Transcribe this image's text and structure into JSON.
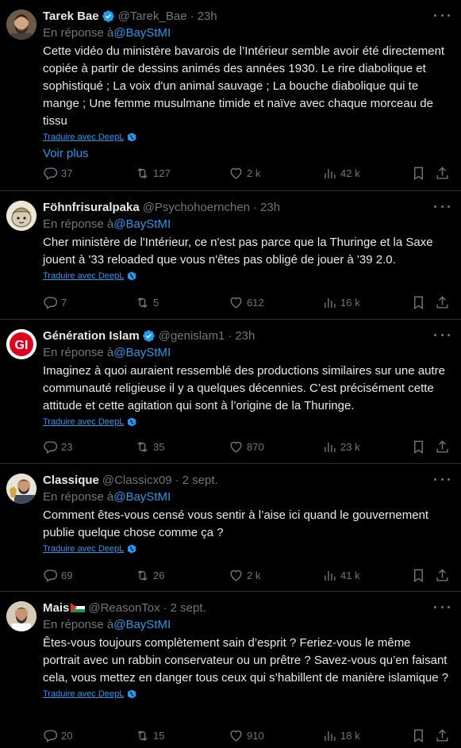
{
  "tweets": [
    {
      "name": "Tarek Bae",
      "verified": true,
      "handle": "@Tarek_Bae",
      "time": "23h",
      "reply_prefix": "En réponse à",
      "reply_to": "@BayStMI",
      "text": "Cette vidéo du ministère bavarois de l’Intérieur semble avoir été directement copiée à partir de dessins animés des années 1930. Le rire diabolique et sophistiqué ; La voix d'un animal sauvage ; La bouche diabolique qui te mange ; Une femme musulmane timide et naïve avec chaque morceau de tissu",
      "translate": "Traduire avec DeepL",
      "see_more": "Voir plus",
      "replies": "37",
      "retweets": "127",
      "likes": "2 k",
      "views": "42 k"
    },
    {
      "name": "Föhnfrisuralpaka",
      "verified": false,
      "handle": "@Psychohoernchen",
      "time": "23h",
      "reply_prefix": "En réponse à",
      "reply_to": "@BayStMI",
      "text": "Cher ministère de l'Intérieur, ce n'est pas parce que la Thuringe et la Saxe jouent à '33 reloaded que vous n'êtes pas obligé de jouer à '39 2.0.",
      "translate": "Traduire avec DeepL",
      "replies": "7",
      "retweets": "5",
      "likes": "612",
      "views": "16 k"
    },
    {
      "name": "Génération Islam",
      "verified": true,
      "handle": "@genislam1",
      "time": "23h",
      "reply_prefix": "En réponse à",
      "reply_to": "@BayStMI",
      "text": "Imaginez à quoi auraient ressemblé des productions similaires sur une autre communauté religieuse il y a quelques décennies. C’est précisément cette attitude et cette agitation qui sont à l’origine de la Thuringe.",
      "translate": "Traduire avec DeepL",
      "replies": "23",
      "retweets": "35",
      "likes": "870",
      "views": "23 k"
    },
    {
      "name": "Classique",
      "verified": false,
      "handle": "@Classicx09",
      "time": "2 sept.",
      "reply_prefix": "En réponse à",
      "reply_to": "@BayStMI",
      "text": "Comment êtes-vous censé vous sentir à l’aise ici quand le gouvernement publie quelque chose comme ça ?",
      "translate": "Traduire avec DeepL",
      "replies": "69",
      "retweets": "26",
      "likes": "2 k",
      "views": "41 k"
    },
    {
      "name": "Mais",
      "verified": false,
      "handle": "@ReasonTox",
      "time": "2 sept.",
      "reply_prefix": "En réponse à",
      "reply_to": "@BayStMI",
      "text": "Êtes-vous toujours complètement sain d’esprit ? Feriez-vous le même portrait avec un rabbin conservateur ou un prêtre ? Savez-vous qu’en faisant cela, vous mettez en danger tous ceux qui s’habillent de manière islamique ?",
      "translate": "Traduire avec DeepL",
      "replies": "20",
      "retweets": "15",
      "likes": "910",
      "views": "18 k"
    }
  ],
  "colors": {
    "background": "#000000",
    "text": "#e7e9ea",
    "muted": "#71767b",
    "accent": "#1d9bf0",
    "divider": "#2f3336",
    "verified": "#1d9bf0"
  },
  "icons": [
    "verified-badge-icon",
    "more-icon",
    "deepl-icon",
    "reply-icon",
    "retweet-icon",
    "like-icon",
    "views-icon",
    "bookmark-icon",
    "share-icon",
    "palestine-flag-icon"
  ]
}
